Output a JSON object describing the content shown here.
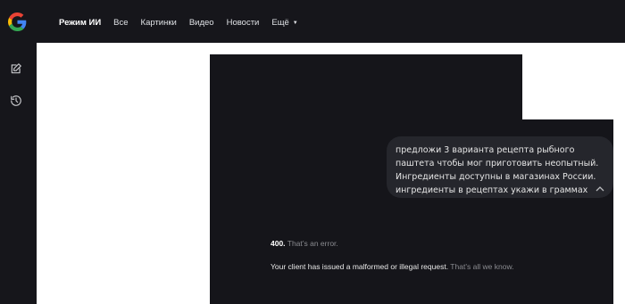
{
  "nav": {
    "items": [
      "Режим ИИ",
      "Все",
      "Картинки",
      "Видео",
      "Новости",
      "Ещё"
    ]
  },
  "sidebar": {
    "icons": [
      "edit-icon",
      "history-icon"
    ]
  },
  "prompt": {
    "text": "предложи 3 варианта рецепта рыбного паштета чтобы мог приготовить неопытный. Ингредиенты доступны в магазинах России. ингредиенты в рецептах укажи в граммах"
  },
  "error": {
    "code": "400.",
    "code_desc": "That’s an error.",
    "message": "Your client has issued a malformed or illegal request.",
    "message_tail": "That’s all we know."
  },
  "colors": {
    "bg_dark": "#16161b",
    "bubble": "#25262c",
    "muted": "#8a8b90"
  }
}
